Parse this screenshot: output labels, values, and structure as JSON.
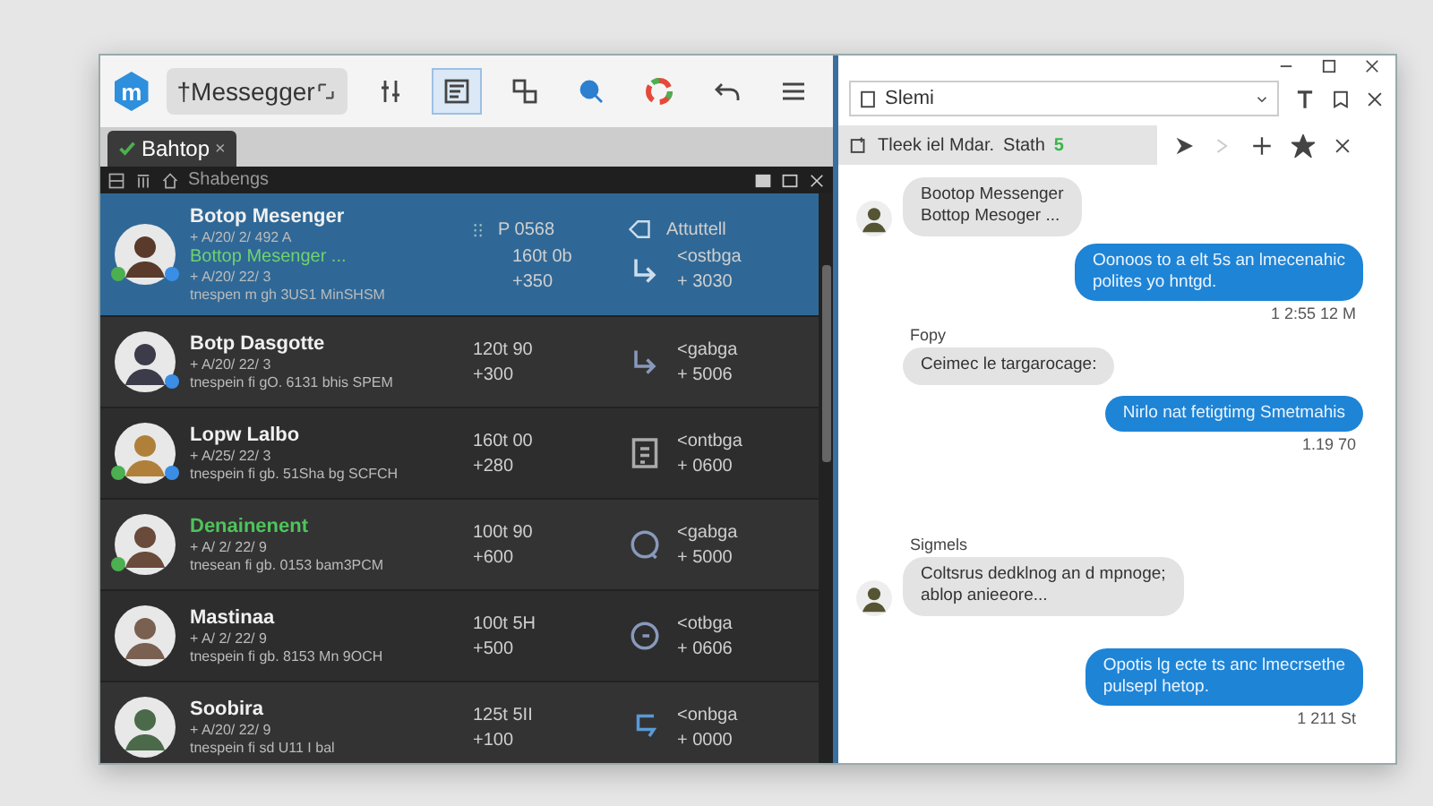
{
  "toolbar": {
    "logo": "m",
    "app_field": "†Messegger",
    "buttons": [
      {
        "selected": false
      },
      {
        "selected": true
      },
      {
        "selected": false
      },
      {
        "selected": false
      },
      {
        "selected": false
      },
      {
        "selected": false
      },
      {
        "selected": false
      }
    ]
  },
  "tab": {
    "label": "Bahtop",
    "close": "×"
  },
  "panel": {
    "title": "Shabengs",
    "columns": [
      "⁝⁝",
      "P 0568",
      "Attuttell"
    ]
  },
  "rows": [
    {
      "name": "Botop Mesenger",
      "date": "+ A/20/ 2/ 492 A",
      "preview": "Bottop Mesenger ...",
      "date_2": "+ A/20/ 22/ 3",
      "detail": "tnespen m gh 3US1 MinSHSM",
      "time": "160t 0b",
      "count": "+350",
      "action": "<ostbga",
      "amount": "+ 3030",
      "selected": true,
      "online": true,
      "verified": true,
      "highlight": false
    },
    {
      "name": "Botp Dasgotte",
      "date": "+ A/20/ 22/ 3",
      "detail": "tnespein fi gO. 6131 bhis SPEM",
      "time": "120t 90",
      "count": "+300",
      "action": "<gabga",
      "amount": "+ 5006",
      "selected": false,
      "online": false,
      "verified": true,
      "highlight": false
    },
    {
      "name": "Lopw Lalbo",
      "date": "+ A/25/ 22/ 3",
      "detail": "tnespein fi gb. 51Sha bg SCFCH",
      "time": "160t 00",
      "count": "+280",
      "action": "<ontbga",
      "amount": "+ 0600",
      "selected": false,
      "online": true,
      "verified": true,
      "highlight": false
    },
    {
      "name": "Denainenent",
      "date": "+ A/ 2/ 22/ 9",
      "detail": "tnesean fi gb. 0153 bam3PCM",
      "time": "100t 90",
      "count": "+600",
      "action": "<gabga",
      "amount": "+ 5000",
      "selected": false,
      "online": true,
      "verified": false,
      "highlight": true
    },
    {
      "name": "Mastinaa",
      "date": "+ A/ 2/ 22/ 9",
      "detail": "tnespein fi gb. 8153 Mn 9OCH",
      "time": "100t 5H",
      "count": "+500",
      "action": "<otbga",
      "amount": "+ 0606",
      "selected": false,
      "online": false,
      "verified": false,
      "highlight": false
    },
    {
      "name": "Soobira",
      "date": "+ A/20/ 22/ 9",
      "detail": "tnespein fi sd U11 I bal",
      "time": "125t 5II",
      "count": "+100",
      "action": "<onbga",
      "amount": "+ 0000",
      "selected": false,
      "online": false,
      "verified": false,
      "highlight": false
    }
  ],
  "chat": {
    "search": "Slemi",
    "tab_label": "Tleek iel Mdar.",
    "tab_status": "Stath",
    "tab_count": "5",
    "messages": [
      {
        "kind": "incoming",
        "lines": [
          "Bootop Messenger",
          "Bottop Mesoger ..."
        ],
        "avatar": true
      },
      {
        "kind": "outgoing",
        "lines": [
          "Oonoos to a elt 5s an lmecenahic",
          "polites yo hntgd."
        ],
        "time": "1 2:55 12 M"
      },
      {
        "kind": "incoming",
        "sender": "Fopy",
        "lines": [
          "Ceimec le targarocage:"
        ],
        "avatar": false
      },
      {
        "kind": "outgoing",
        "lines": [
          "Nirlo nat fetigtimg Smetmahis"
        ],
        "time": "1.19 70"
      },
      {
        "kind": "incoming",
        "sender": "Sigmels",
        "lines": [
          "Coltsrus dedklnog an d mpnoge;",
          "ablop anieeore..."
        ],
        "avatar": true
      },
      {
        "kind": "outgoing",
        "lines": [
          "Opotis lg ecte ts anc lmecrsethe",
          "pulsepl hetop."
        ],
        "time": "1 211 St"
      }
    ]
  }
}
